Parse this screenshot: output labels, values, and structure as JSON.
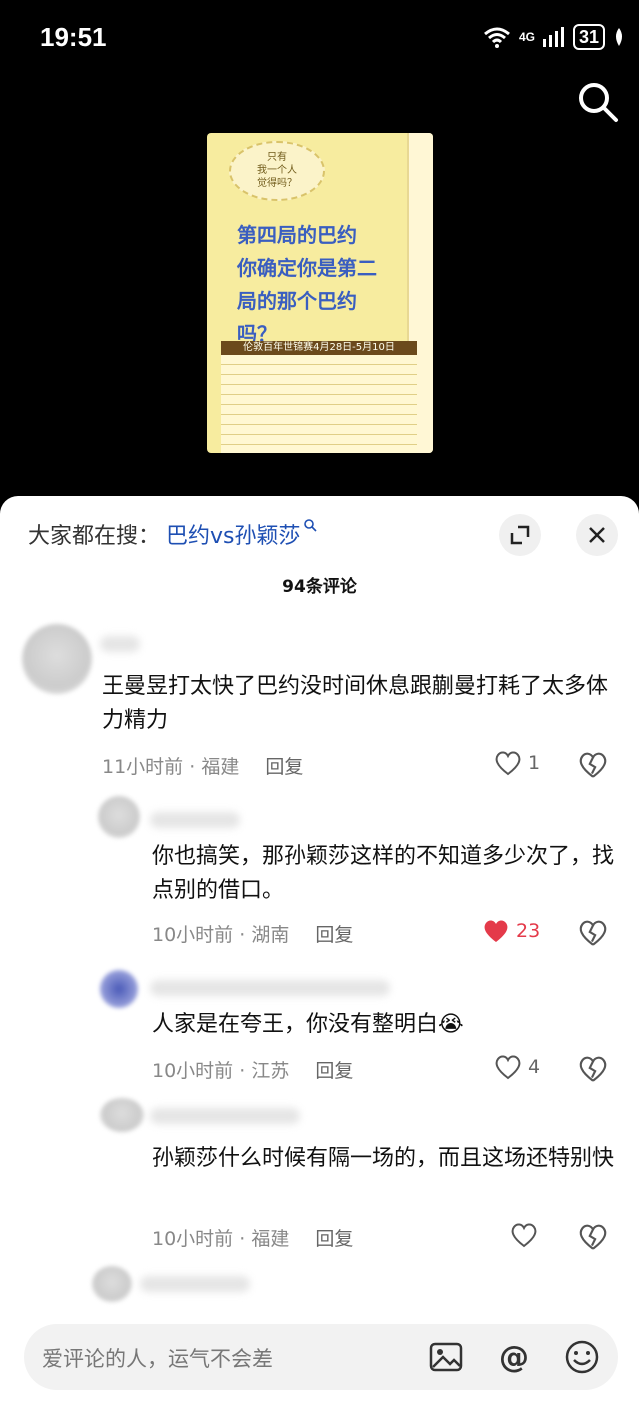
{
  "status": {
    "time": "19:51",
    "network": "4G",
    "battery": "31"
  },
  "video": {
    "bubble": "只有\n我一个人\n觉得吗？",
    "caption": "第四局的巴约\n你确定你是第二\n局的那个巴约\n吗？",
    "table_title": "伦敦百年世锦赛4月28日-5月10日"
  },
  "sheet": {
    "trend_label": "大家都在搜：",
    "trend_term": "巴约vs孙颖莎",
    "comment_count": "94条评论",
    "comments": [
      {
        "text": "王曼昱打太快了巴约没时间休息跟蒯曼打耗了太多体力精力",
        "time": "11小时前",
        "loc": "福建",
        "reply": "回复",
        "likes": "1"
      },
      {
        "text": "你也搞笑，那孙颖莎这样的不知道多少次了，找点别的借口。",
        "time": "10小时前",
        "loc": "湖南",
        "reply": "回复",
        "likes": "23"
      },
      {
        "text": "人家是在夸王，你没有整明白😭",
        "time": "10小时前",
        "loc": "江苏",
        "reply": "回复",
        "likes": "4"
      },
      {
        "text": "孙颖莎什么时候有隔一场的，而且这场还特别快",
        "time": "10小时前",
        "loc": "福建",
        "reply": "回复",
        "likes": ""
      }
    ],
    "input_placeholder": "爱评论的人，运气不会差"
  },
  "colors": {
    "link_blue": "#1e4fb3",
    "like_red": "#e43a4a"
  }
}
